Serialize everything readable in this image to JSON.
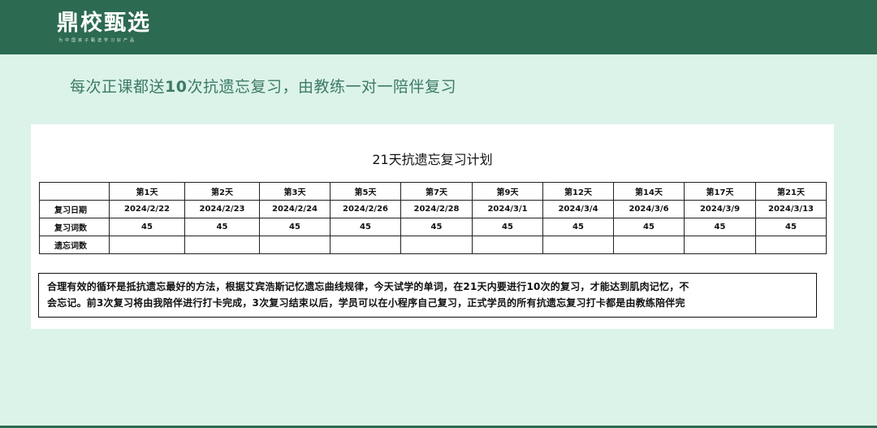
{
  "brand": {
    "logo_text": "鼎校甄选",
    "tagline": "为中国孩子甄选学习好产品"
  },
  "headline": {
    "prefix": "每次正课都送",
    "number": "10",
    "suffix": "次抗遗忘复习，由教练一对一陪伴复习"
  },
  "plan": {
    "title": "21天抗遗忘复习计划",
    "day_headers": [
      "第1天",
      "第2天",
      "第3天",
      "第5天",
      "第7天",
      "第9天",
      "第12天",
      "第14天",
      "第17天",
      "第21天"
    ],
    "rows": [
      {
        "label": "复习日期",
        "cells": [
          "2024/2/22",
          "2024/2/23",
          "2024/2/24",
          "2024/2/26",
          "2024/2/28",
          "2024/3/1",
          "2024/3/4",
          "2024/3/6",
          "2024/3/9",
          "2024/3/13"
        ]
      },
      {
        "label": "复习词数",
        "cells": [
          "45",
          "45",
          "45",
          "45",
          "45",
          "45",
          "45",
          "45",
          "45",
          "45"
        ]
      },
      {
        "label": "遗忘词数",
        "cells": [
          "",
          "",
          "",
          "",
          "",
          "",
          "",
          "",
          "",
          ""
        ]
      }
    ]
  },
  "note": {
    "line1": "合理有效的循环是抵抗遗忘最好的方法，根据艾宾浩斯记忆遗忘曲线规律，今天试学的单词，在21天内要进行10次的复习，才能达到肌肉记忆，不",
    "line2": "会忘记。前3次复习将由我陪伴进行打卡完成，3次复习结束以后，学员可以在小程序自己复习，正式学员的所有抗遗忘复习打卡都是由教练陪伴完"
  }
}
